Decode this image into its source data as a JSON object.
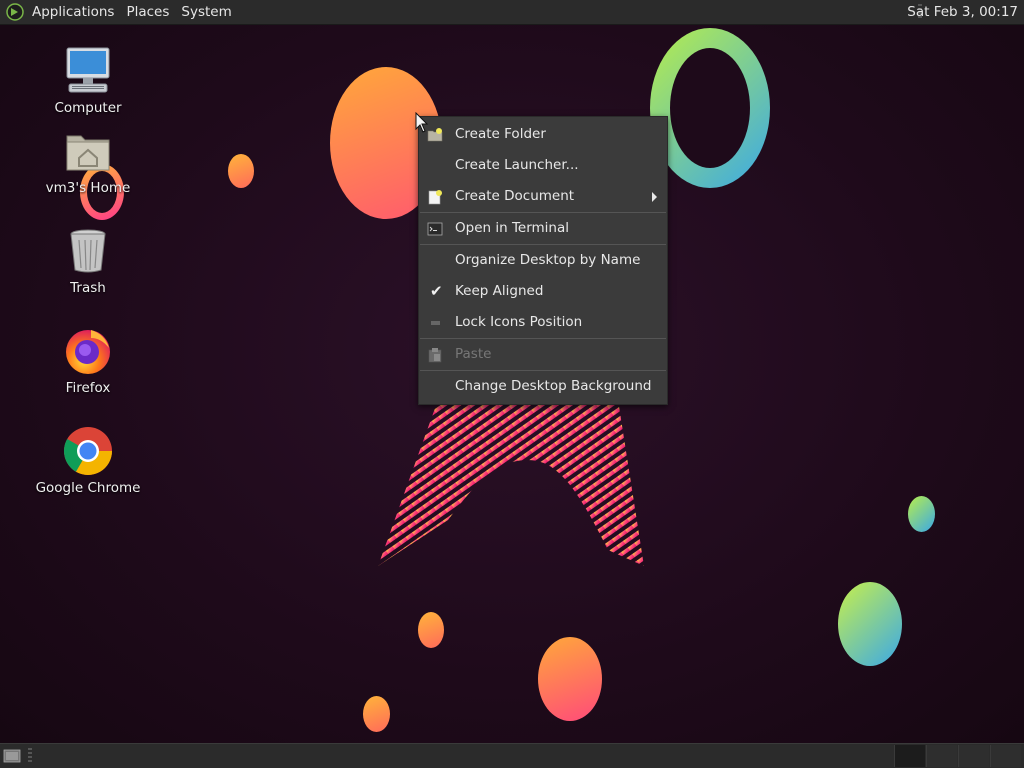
{
  "top_panel": {
    "menus": [
      "Applications",
      "Places",
      "System"
    ],
    "clock": "Sat Feb  3, 00:17"
  },
  "desktop_icons": [
    {
      "label": "Computer",
      "icon": "computer-icon"
    },
    {
      "label": "vm3's Home",
      "icon": "home-folder-icon"
    },
    {
      "label": "Trash",
      "icon": "trash-icon"
    },
    {
      "label": "Firefox",
      "icon": "firefox-icon"
    },
    {
      "label": "Google Chrome",
      "icon": "chrome-icon"
    }
  ],
  "context_menu": {
    "items": [
      {
        "label": "Create Folder",
        "icon": "new-folder-icon"
      },
      {
        "label": "Create Launcher..."
      },
      {
        "label": "Create Document",
        "icon": "new-document-icon",
        "submenu": true
      },
      {
        "label": "Open in Terminal",
        "icon": "terminal-icon"
      },
      {
        "label": "Organize Desktop by Name"
      },
      {
        "label": "Keep Aligned",
        "checked": true
      },
      {
        "label": "Lock Icons Position"
      },
      {
        "label": "Paste",
        "icon": "paste-icon",
        "disabled": true
      },
      {
        "label": "Change Desktop Background"
      }
    ]
  },
  "bottom_panel": {
    "workspaces": 4,
    "active_workspace": 1
  },
  "colors": {
    "panel_bg": "#2b2b2b",
    "menu_bg": "#3b3b3b",
    "desktop_bg": "#220d1c"
  }
}
